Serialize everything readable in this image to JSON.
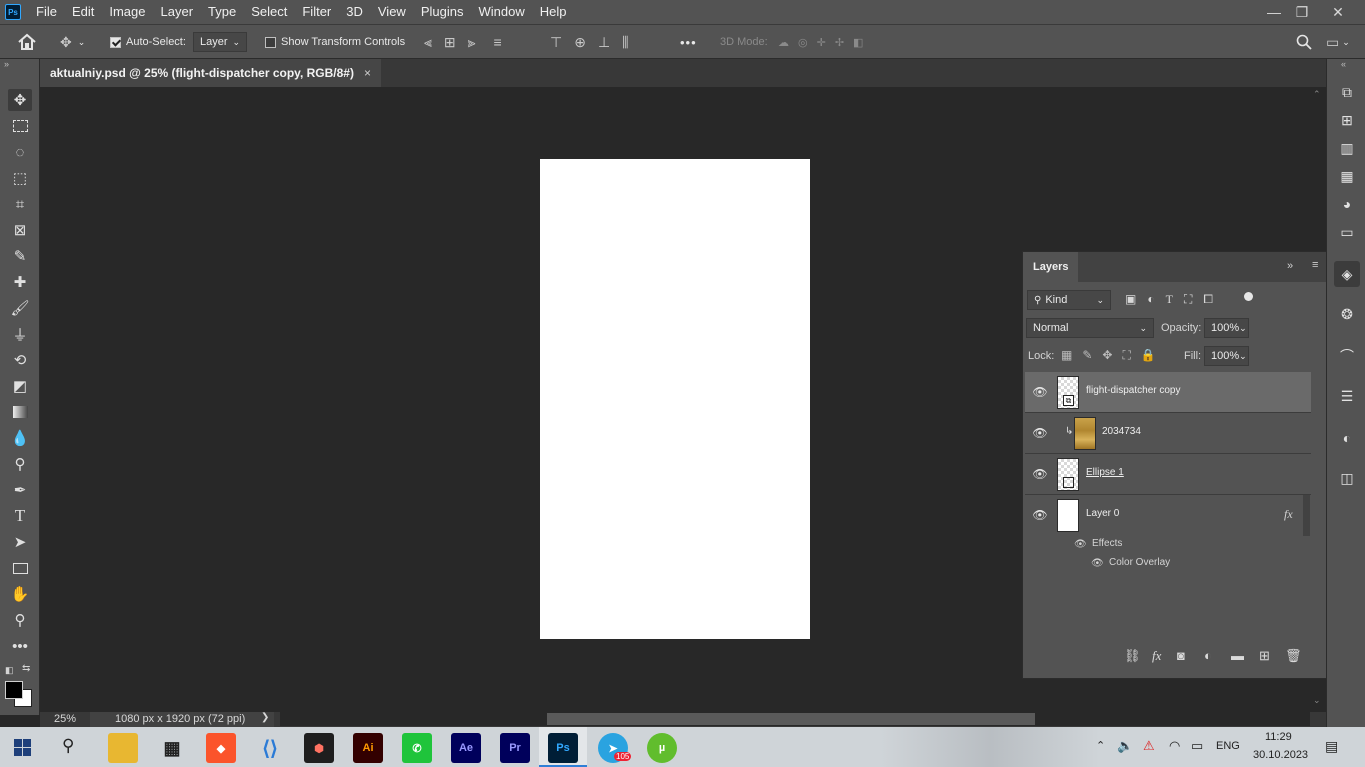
{
  "app": {
    "logo": "Ps"
  },
  "menu": [
    "File",
    "Edit",
    "Image",
    "Layer",
    "Type",
    "Select",
    "Filter",
    "3D",
    "View",
    "Plugins",
    "Window",
    "Help"
  ],
  "window_controls": {
    "minimize": "—",
    "maximize": "❐",
    "close": "✕"
  },
  "options": {
    "auto_select_label": "Auto-Select:",
    "auto_select_checked": true,
    "auto_select_target": "Layer",
    "transform_controls_label": "Show Transform Controls",
    "more": "•••",
    "mode_3d_label": "3D Mode:"
  },
  "document": {
    "tab_title": "aktualniy.psd @ 25% (flight-dispatcher copy, RGB/8#)",
    "close": "×"
  },
  "status": {
    "zoom": "25%",
    "info": "1080 px x 1920 px (72 ppi)",
    "arrow": "❯"
  },
  "layers_panel": {
    "title": "Layers",
    "filter_kind": "Kind",
    "blend_mode": "Normal",
    "opacity_label": "Opacity:",
    "opacity_value": "100%",
    "lock_label": "Lock:",
    "fill_label": "Fill:",
    "fill_value": "100%",
    "layers": [
      {
        "name": "flight-dispatcher copy",
        "selected": true
      },
      {
        "name": "2034734",
        "clipped": true
      },
      {
        "name": "Ellipse 1"
      },
      {
        "name": "Layer 0",
        "fx": "fx"
      }
    ],
    "effects_label": "Effects",
    "effect_item": "Color Overlay"
  },
  "taskbar": {
    "apps": [
      "Brave",
      "VS Code",
      "Figma",
      "Ai",
      "Ae",
      "Pr",
      "Ps",
      "Telegram",
      "uTorrent"
    ],
    "telegram_badge": "105",
    "lang": "ENG",
    "time": "11:29",
    "date": "30.10.2023"
  }
}
